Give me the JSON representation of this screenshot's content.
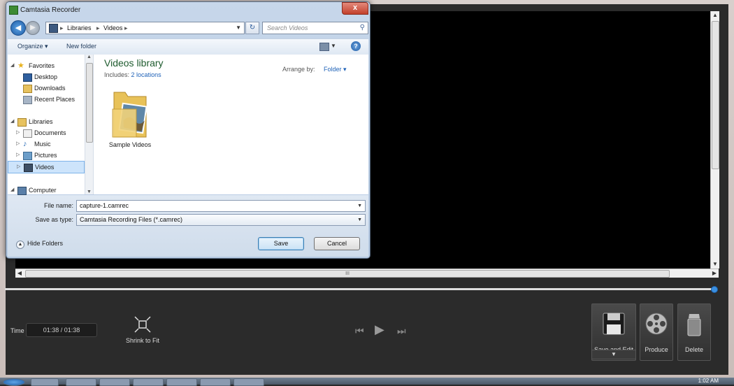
{
  "dialog": {
    "title": "Camtasia Recorder",
    "close_label": "x",
    "address": {
      "crumbs": [
        "Libraries",
        "Videos"
      ]
    },
    "search_placeholder": "Search Videos",
    "toolbar": {
      "organize": "Organize ▾",
      "new_folder": "New folder"
    },
    "nav": {
      "favorites": "Favorites",
      "desktop": "Desktop",
      "downloads": "Downloads",
      "recent": "Recent Places",
      "libraries": "Libraries",
      "documents": "Documents",
      "music": "Music",
      "pictures": "Pictures",
      "videos": "Videos",
      "computer": "Computer"
    },
    "library": {
      "title": "Videos library",
      "includes_prefix": "Includes:",
      "includes_link": "2 locations",
      "arrange_label": "Arrange by:",
      "arrange_value": "Folder ▾",
      "item": "Sample Videos"
    },
    "file_name_label": "File name:",
    "file_name_value": "capture-1.camrec",
    "save_type_label": "Save as type:",
    "save_type_value": "Camtasia Recording Files (*.camrec)",
    "hide_folders": "Hide Folders",
    "save": "Save",
    "cancel": "Cancel"
  },
  "recorder": {
    "time_label": "Time",
    "time_value": "01:38  /  01:38",
    "shrink_to_fit": "Shrink to Fit",
    "save_and_edit": "Save and Edit",
    "produce": "Produce",
    "delete": "Delete",
    "scroll_grip": "III"
  },
  "taskbar": {
    "clock": "1:02 AM"
  },
  "colors": {
    "accent": "#1f62b8",
    "library_title": "#1e5b2e",
    "progress_knob": "#3a8fe0"
  }
}
